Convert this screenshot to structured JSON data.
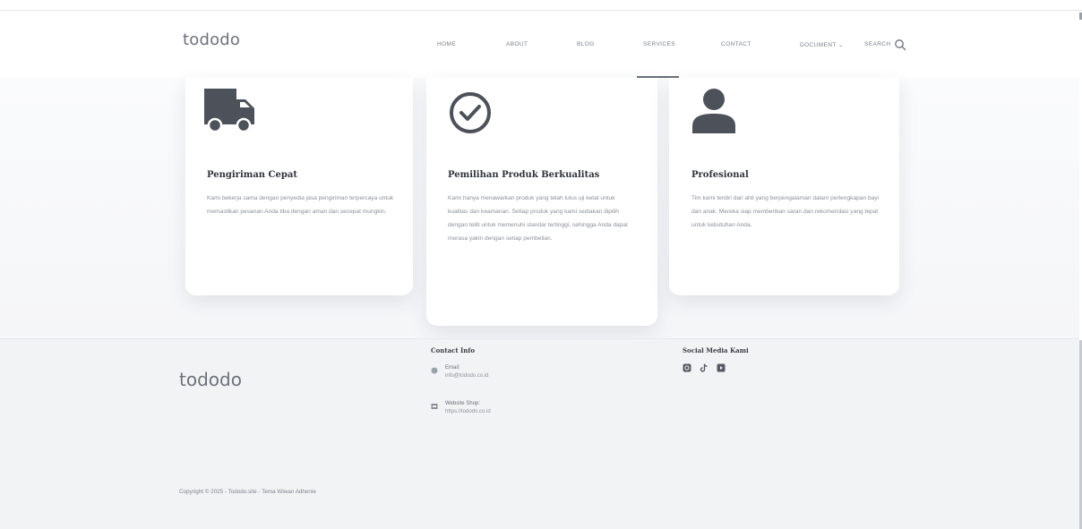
{
  "brand": {
    "logo_text": "tododo"
  },
  "nav": {
    "items": [
      {
        "label": "HOME"
      },
      {
        "label": "ABOUT"
      },
      {
        "label": "BLOG"
      },
      {
        "label": "SERVICES"
      },
      {
        "label": "CONTACT"
      },
      {
        "label": "DOCUMENT ⌄"
      },
      {
        "label": "SEARCH"
      }
    ],
    "active": "SERVICES"
  },
  "cards": [
    {
      "icon": "delivery-truck-icon",
      "title": "Pengiriman Cepat",
      "text": "Kami bekerja sama dengan penyedia jasa pengiriman terpercaya untuk memastikan pesanan Anda tiba dengan aman dan secepat mungkin."
    },
    {
      "icon": "check-circle-icon",
      "title": "Pemilihan Produk Berkualitas",
      "text": "Kami hanya menawarkan produk yang telah lulus uji ketat untuk kualitas dan keamanan. Setiap produk yang kami sediakan dipilih dengan teliti untuk memenuhi standar tertinggi, sehingga Anda dapat merasa yakin dengan setiap pembelian."
    },
    {
      "icon": "user-icon",
      "title": "Profesional",
      "text": "Tim kami terdiri dari ahli yang berpengalaman dalam perlengkapan bayi dan anak. Mereka siap memberikan saran dan rekomendasi yang tepat untuk kebutuhan Anda."
    }
  ],
  "footer": {
    "logo_text": "tododo",
    "contact": {
      "heading": "Contact Info",
      "email_label": "Email:",
      "email_value": "info@tododo.co.id",
      "website_label": "Website Shop:",
      "website_value": "https://tododo.co.id"
    },
    "social": {
      "heading": "Social Media Kami",
      "icons": [
        "instagram-icon",
        "tiktok-icon",
        "youtube-icon"
      ]
    },
    "copyright": "Copyright © 2025 - Tododo.site - Tema Wiwan Adhenie"
  },
  "colors": {
    "navbar_bg": "#ffffff",
    "content_bg": "#f6f7f9",
    "footer_bg": "#f2f3f5",
    "icon_color": "#4d525a",
    "active_underline": "#6b7079"
  }
}
